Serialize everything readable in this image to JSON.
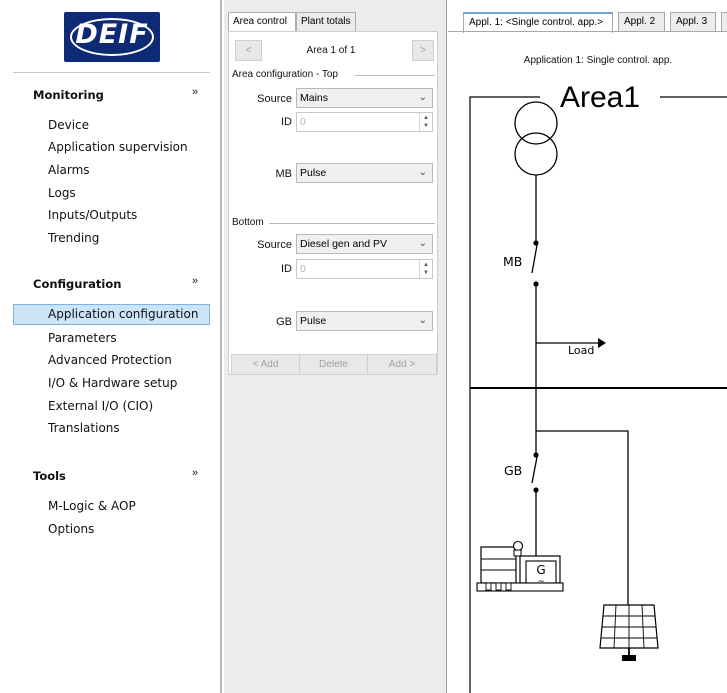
{
  "brand": {
    "logo_text": "DEIF",
    "logo_color": "#0e2a74"
  },
  "nav": {
    "sections": [
      {
        "title": "Monitoring",
        "items": [
          "Device",
          "Application supervision",
          "Alarms",
          "Logs",
          "Inputs/Outputs",
          "Trending"
        ]
      },
      {
        "title": "Configuration",
        "items": [
          "Application configuration",
          "Parameters",
          "Advanced Protection",
          "I/O & Hardware setup",
          "External I/O (CIO)",
          "Translations"
        ]
      },
      {
        "title": "Tools",
        "items": [
          "M-Logic & AOP",
          "Options"
        ]
      }
    ],
    "collapse_glyph": "»",
    "selected_item": "Application configuration",
    "selected_color": "#cce4f7"
  },
  "mid": {
    "tabs": [
      "Area control",
      "Plant totals"
    ],
    "active_tab": "Area control",
    "pager": {
      "prev": "<",
      "label": "Area 1 of 1",
      "next": ">"
    },
    "top_group": "Area configuration - Top",
    "top": {
      "source_label": "Source",
      "source_value": "Mains",
      "id_label": "ID",
      "id_value": "0",
      "breaker_label": "MB",
      "breaker_value": "Pulse"
    },
    "bottom_group": "Bottom",
    "bottom": {
      "source_label": "Source",
      "source_value": "Diesel gen and PV",
      "id_label": "ID",
      "id_value": "0",
      "breaker_label": "GB",
      "breaker_value": "Pulse"
    },
    "actions": {
      "add_left": "< Add",
      "delete": "Delete",
      "add_right": "Add >"
    }
  },
  "right": {
    "tabs": [
      "Appl. 1: <Single control. app.>",
      "Appl. 2",
      "Appl. 3",
      "A"
    ],
    "active_tab": "Appl. 1: <Single control. app.>",
    "caption": "Application 1: Single control. app.",
    "diagram": {
      "area_title": "Area1",
      "mains_breaker": "MB",
      "load_label": "Load",
      "gen_breaker": "GB",
      "gen_symbol": "G",
      "gen_wave": "~"
    }
  },
  "icons": [
    "chevron-down-icon",
    "spin-arrows-icon",
    "transformer-icon",
    "genset-icon",
    "solar-panel-icon",
    "ground-icon",
    "arrow-right-icon",
    "collapse-icon"
  ]
}
